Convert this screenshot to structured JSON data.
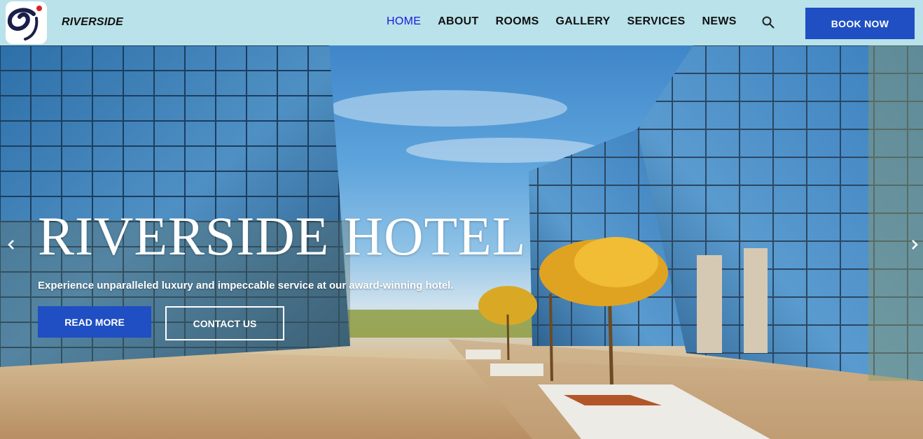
{
  "header": {
    "brand": "RIVERSIDE",
    "logo_icon": "hotel-logo",
    "nav": [
      {
        "label": "HOME",
        "active": true
      },
      {
        "label": "ABOUT",
        "active": false
      },
      {
        "label": "ROOMS",
        "active": false
      },
      {
        "label": "GALLERY",
        "active": false
      },
      {
        "label": "SERVICES",
        "active": false
      },
      {
        "label": "NEWS",
        "active": false
      }
    ],
    "search_icon": "search-icon",
    "book_label": "BOOK NOW"
  },
  "hero": {
    "title": "RIVERSIDE HOTEL",
    "subtitle": "Experience unparalleled luxury and impeccable service at our award-winning hotel.",
    "read_more_label": "READ MORE",
    "contact_label": "CONTACT US",
    "prev_icon": "chevron-left-icon",
    "next_icon": "chevron-right-icon"
  },
  "colors": {
    "header_bg": "#b9e2ea",
    "accent": "#1f4fc2",
    "active_nav": "#1a1adc"
  }
}
